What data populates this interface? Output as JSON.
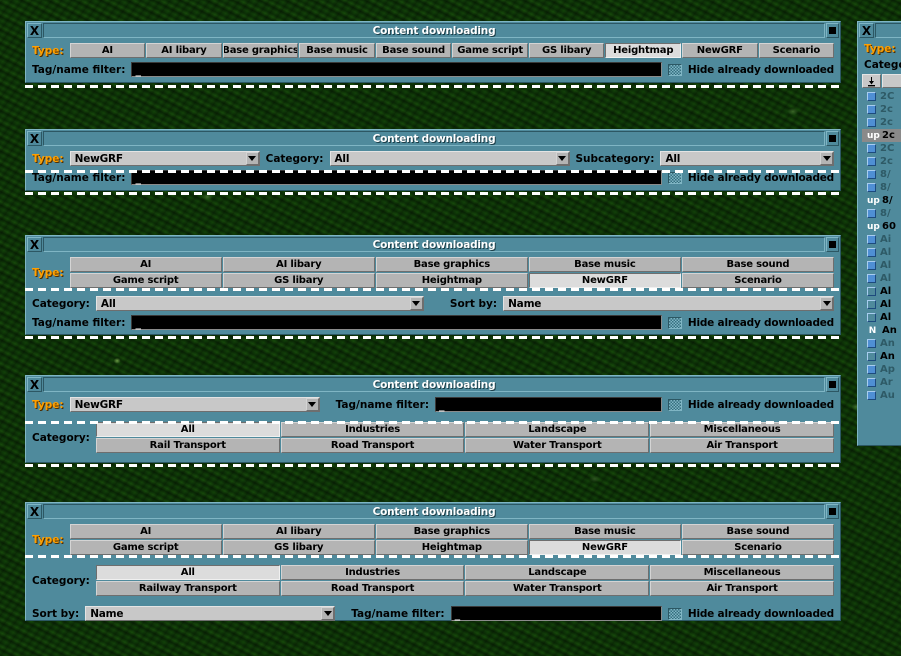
{
  "app": {
    "title": "Content downloading"
  },
  "labels": {
    "type": "Type:",
    "category": "Category:",
    "subcategory": "Subcategory:",
    "sort_by": "Sort by:",
    "tag_filter": "Tag/name filter:",
    "hide_downloaded": "Hide already downloaded",
    "close": "X",
    "caret": "_"
  },
  "type_buttons": [
    "AI",
    "AI libary",
    "Base graphics",
    "Base music",
    "Base sound",
    "Game script",
    "GS libary",
    "Heightmap",
    "NewGRF",
    "Scenario"
  ],
  "category_buttons": [
    "All",
    "Industries",
    "Landscape",
    "Miscellaneous",
    "Rail Transport",
    "Road Transport",
    "Water Transport",
    "Air Transport"
  ],
  "category_buttons_railway": [
    "All",
    "Industries",
    "Landscape",
    "Miscellaneous",
    "Railway Transport",
    "Road Transport",
    "Water Transport",
    "Air Transport"
  ],
  "windows": [
    {
      "id": "win-1",
      "title": "Content downloading",
      "type_selected": "Heightmap",
      "filter_value": "",
      "hide_downloaded_checked": true
    },
    {
      "id": "win-2",
      "title": "Content downloading",
      "type_dropdown": "NewGRF",
      "category_dropdown": "All",
      "subcategory_dropdown": "All",
      "filter_value": "",
      "hide_downloaded_checked": true
    },
    {
      "id": "win-3",
      "title": "Content downloading",
      "type_selected": "NewGRF",
      "category_dropdown": "All",
      "sort_by_dropdown": "Name",
      "filter_value": "",
      "hide_downloaded_checked": true
    },
    {
      "id": "win-4",
      "title": "Content downloading",
      "type_dropdown": "NewGRF",
      "category_selected": "All",
      "filter_value": "",
      "hide_downloaded_checked": true
    },
    {
      "id": "win-5",
      "title": "Content downloading",
      "type_selected": "NewGRF",
      "category_selected": "All",
      "sort_by_dropdown": "Name",
      "filter_value": "",
      "hide_downloaded_checked": true
    }
  ],
  "side_window": {
    "title": "",
    "type_label": "Type:",
    "category_label": "Catego",
    "download_icon": "download-arrow-icon",
    "rows": [
      {
        "flag": "box",
        "text": "2C",
        "tone": "grey",
        "hl": false
      },
      {
        "flag": "box",
        "text": "2c",
        "tone": "grey",
        "hl": false
      },
      {
        "flag": "box",
        "text": "2c",
        "tone": "grey",
        "hl": false
      },
      {
        "flag": "up",
        "text": "2c",
        "tone": "dark",
        "hl": true
      },
      {
        "flag": "box",
        "text": "2C",
        "tone": "grey",
        "hl": false
      },
      {
        "flag": "box",
        "text": "2c",
        "tone": "grey",
        "hl": false
      },
      {
        "flag": "box",
        "text": "8/",
        "tone": "grey",
        "hl": false
      },
      {
        "flag": "box",
        "text": "8/",
        "tone": "grey",
        "hl": false
      },
      {
        "flag": "up",
        "text": "8/",
        "tone": "dark",
        "hl": false
      },
      {
        "flag": "box",
        "text": "8/",
        "tone": "grey",
        "hl": false
      },
      {
        "flag": "up",
        "text": "60",
        "tone": "dark",
        "hl": false
      },
      {
        "flag": "box",
        "text": "Ai",
        "tone": "grey",
        "hl": false
      },
      {
        "flag": "box",
        "text": "Al",
        "tone": "grey",
        "hl": false
      },
      {
        "flag": "box",
        "text": "Al",
        "tone": "grey",
        "hl": false
      },
      {
        "flag": "box",
        "text": "Al",
        "tone": "grey",
        "hl": false
      },
      {
        "flag": "empty",
        "text": "Al",
        "tone": "dark",
        "hl": false
      },
      {
        "flag": "empty",
        "text": "Al",
        "tone": "dark",
        "hl": false
      },
      {
        "flag": "empty",
        "text": "Al",
        "tone": "dark",
        "hl": false
      },
      {
        "flag": "N",
        "text": "An",
        "tone": "dark",
        "hl": false
      },
      {
        "flag": "box",
        "text": "An",
        "tone": "grey",
        "hl": false
      },
      {
        "flag": "empty",
        "text": "An",
        "tone": "dark",
        "hl": false
      },
      {
        "flag": "box",
        "text": "Ap",
        "tone": "grey",
        "hl": false
      },
      {
        "flag": "box",
        "text": "Ar",
        "tone": "grey",
        "hl": false
      },
      {
        "flag": "box",
        "text": "Au",
        "tone": "grey",
        "hl": false
      }
    ]
  },
  "colors": {
    "window_bg": "#4f8a9c",
    "button_face": "#b4b4b4",
    "button_selected": "#dcdcdc",
    "label_accent": "#ffa000",
    "caption_text": "#ffffff",
    "editbox_bg": "#000000"
  }
}
